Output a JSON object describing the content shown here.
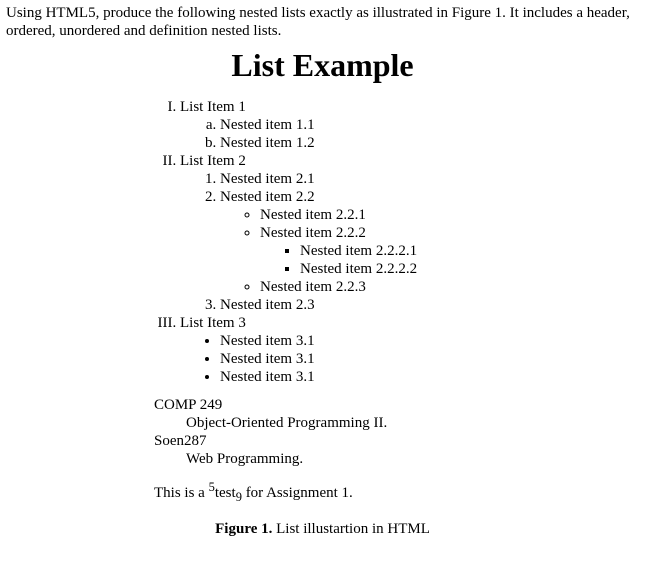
{
  "intro": "Using HTML5, produce the following nested lists exactly as illustrated in Figure 1. It includes a header, ordered, unordered and definition nested lists.",
  "title": "List Example",
  "list": {
    "i1": {
      "label": "List Item 1",
      "a": "Nested item 1.1",
      "b": "Nested item 1.2"
    },
    "i2": {
      "label": "List Item 2",
      "n1": "Nested item 2.1",
      "n2": {
        "label": "Nested item 2.2",
        "c1": "Nested item 2.2.1",
        "c2": {
          "label": "Nested item 2.2.2",
          "s1": "Nested item 2.2.2.1",
          "s2": "Nested item 2.2.2.2"
        },
        "c3": "Nested item 2.2.3"
      },
      "n3": "Nested item 2.3"
    },
    "i3": {
      "label": "List Item 3",
      "d1": "Nested item 3.1",
      "d2": "Nested item 3.1",
      "d3": "Nested item 3.1"
    }
  },
  "defs": {
    "t1": "COMP 249",
    "d1": "Object-Oriented Programming II.",
    "t2": "Soen287",
    "d2": "Web Programming."
  },
  "footnote": {
    "pre": "This is a ",
    "sup": "5",
    "mid": "test",
    "sub": "9",
    "post": " for Assignment 1."
  },
  "caption": {
    "strong": "Figure 1.",
    "rest": " List illustartion in HTML"
  }
}
